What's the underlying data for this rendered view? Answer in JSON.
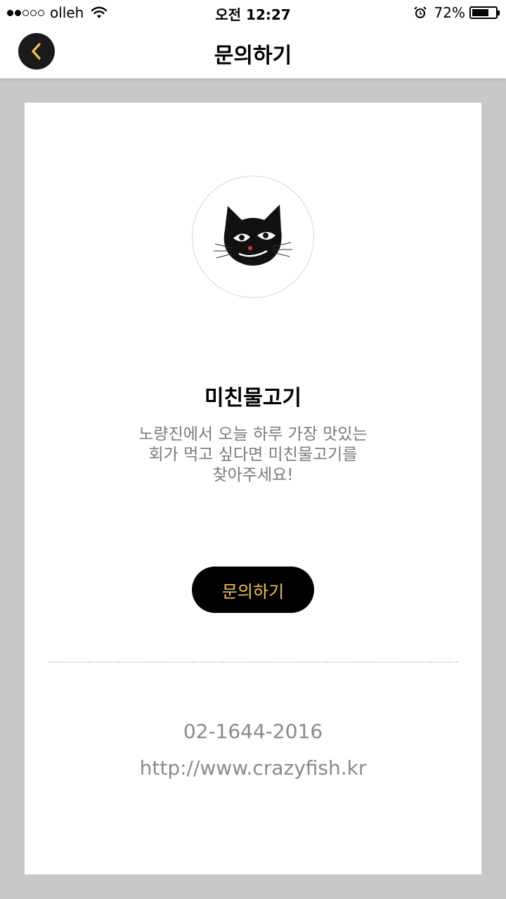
{
  "status_bar": {
    "carrier": "olleh",
    "signal_bars_filled": 2,
    "signal_bars_total": 5,
    "time": "오전 12:27",
    "battery_percent": "72%",
    "battery_level": 0.72,
    "icons": [
      "wifi-icon",
      "alarm-icon",
      "battery-icon"
    ]
  },
  "nav": {
    "title": "문의하기",
    "back_icon": "chevron-left-icon"
  },
  "store": {
    "logo_icon": "black-cat-logo",
    "name": "미친물고기",
    "description_lines": [
      "노량진에서 오늘 하루 가장 맛있는",
      "회가 먹고 싶다면 미친물고기를",
      "찾아주세요!"
    ],
    "inquiry_button_label": "문의하기",
    "phone": "02-1644-2016",
    "website": "http://www.crazyfish.kr"
  },
  "colors": {
    "background": "#c8c8c8",
    "accent_yellow": "#f5c445",
    "button_black": "#000000",
    "secondary_text": "#8a8a8a"
  }
}
